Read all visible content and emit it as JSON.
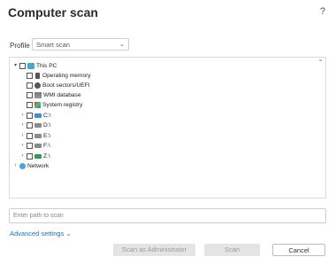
{
  "title": "Computer scan",
  "help": "?",
  "profile": {
    "label": "Profile",
    "value": "Smart scan"
  },
  "tree": [
    {
      "label": "This PC",
      "expander": "▾",
      "icon": "pc"
    },
    {
      "label": "Operating memory",
      "expander": "",
      "icon": "mem"
    },
    {
      "label": "Boot sectors/UEFI",
      "expander": "",
      "icon": "boot"
    },
    {
      "label": "WMI database",
      "expander": "",
      "icon": "wmi"
    },
    {
      "label": "System registry",
      "expander": "",
      "icon": "reg"
    },
    {
      "label": "C:\\",
      "expander": "›",
      "icon": "drive-blue"
    },
    {
      "label": "D:\\",
      "expander": "›",
      "icon": "drive"
    },
    {
      "label": "E:\\",
      "expander": "›",
      "icon": "drive"
    },
    {
      "label": "F:\\",
      "expander": "›",
      "icon": "drive"
    },
    {
      "label": "Z:\\",
      "expander": "›",
      "icon": "drive-green"
    },
    {
      "label": "Network",
      "expander": "›",
      "icon": "net"
    }
  ],
  "path_input": {
    "placeholder": "Enter path to scan"
  },
  "advanced": {
    "label": "Advanced settings",
    "chevron": "⌄"
  },
  "buttons": {
    "admin": "Scan as Administrator",
    "scan": "Scan",
    "cancel": "Cancel"
  }
}
